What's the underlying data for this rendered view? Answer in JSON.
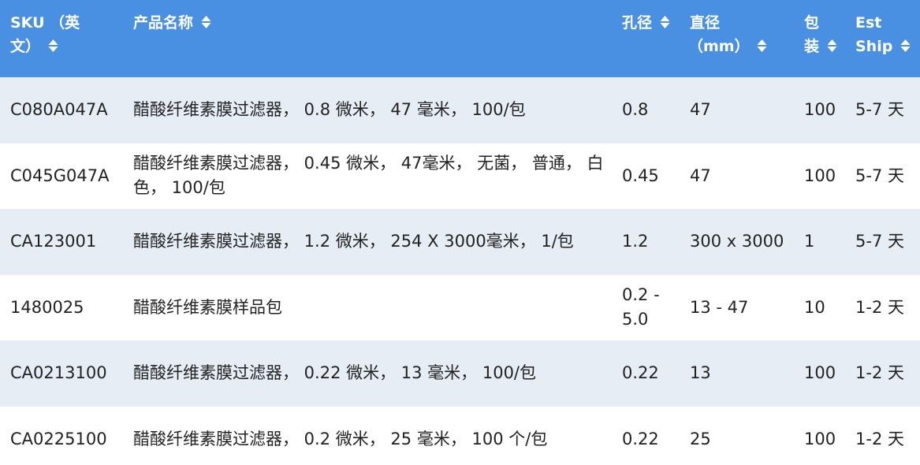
{
  "table": {
    "headers": {
      "sku": [
        "SKU （英",
        "文）"
      ],
      "name": "产品名称",
      "pore": "孔径",
      "diameter": [
        "直径",
        "（mm）"
      ],
      "pack": [
        "包",
        "装"
      ],
      "ship": [
        "Est",
        "Ship"
      ]
    },
    "rows": [
      {
        "sku": "C080A047A",
        "name": "醋酸纤维素膜过滤器， 0.8 微米， 47 毫米， 100/包",
        "pore": "0.8",
        "diameter": "47",
        "pack": "100",
        "ship": "5-7 天"
      },
      {
        "sku": "C045G047A",
        "name": "醋酸纤维素膜过滤器， 0.45 微米， 47毫米， 无菌， 普通， 白色， 100/包",
        "pore": "0.45",
        "diameter": "47",
        "pack": "100",
        "ship": "5-7 天"
      },
      {
        "sku": "CA123001",
        "name": "醋酸纤维素膜过滤器， 1.2 微米， 254 X 3000毫米， 1/包",
        "pore": "1.2",
        "diameter": "300 x 3000",
        "pack": "1",
        "ship": "5-7 天"
      },
      {
        "sku": "1480025",
        "name": "醋酸纤维素膜样品包",
        "pore": "0.2 - 5.0",
        "diameter": "13 - 47",
        "pack": "10",
        "ship": "1-2 天"
      },
      {
        "sku": "CA0213100",
        "name": "醋酸纤维素膜过滤器， 0.22 微米， 13 毫米， 100/包",
        "pore": "0.22",
        "diameter": "13",
        "pack": "100",
        "ship": "1-2 天"
      },
      {
        "sku": "CA0225100",
        "name": "醋酸纤维素膜过滤器， 0.2 微米， 25 毫米， 100 个/包",
        "pore": "0.22",
        "diameter": "25",
        "pack": "100",
        "ship": "1-2 天"
      }
    ]
  },
  "icons": {
    "sort": "sort-up-down-icon"
  },
  "colors": {
    "header_bg": "#4a90e2",
    "header_text": "#ffffff",
    "row_alt": "#e7edf5",
    "row_plain": "#ffffff",
    "body_text": "#222222"
  }
}
